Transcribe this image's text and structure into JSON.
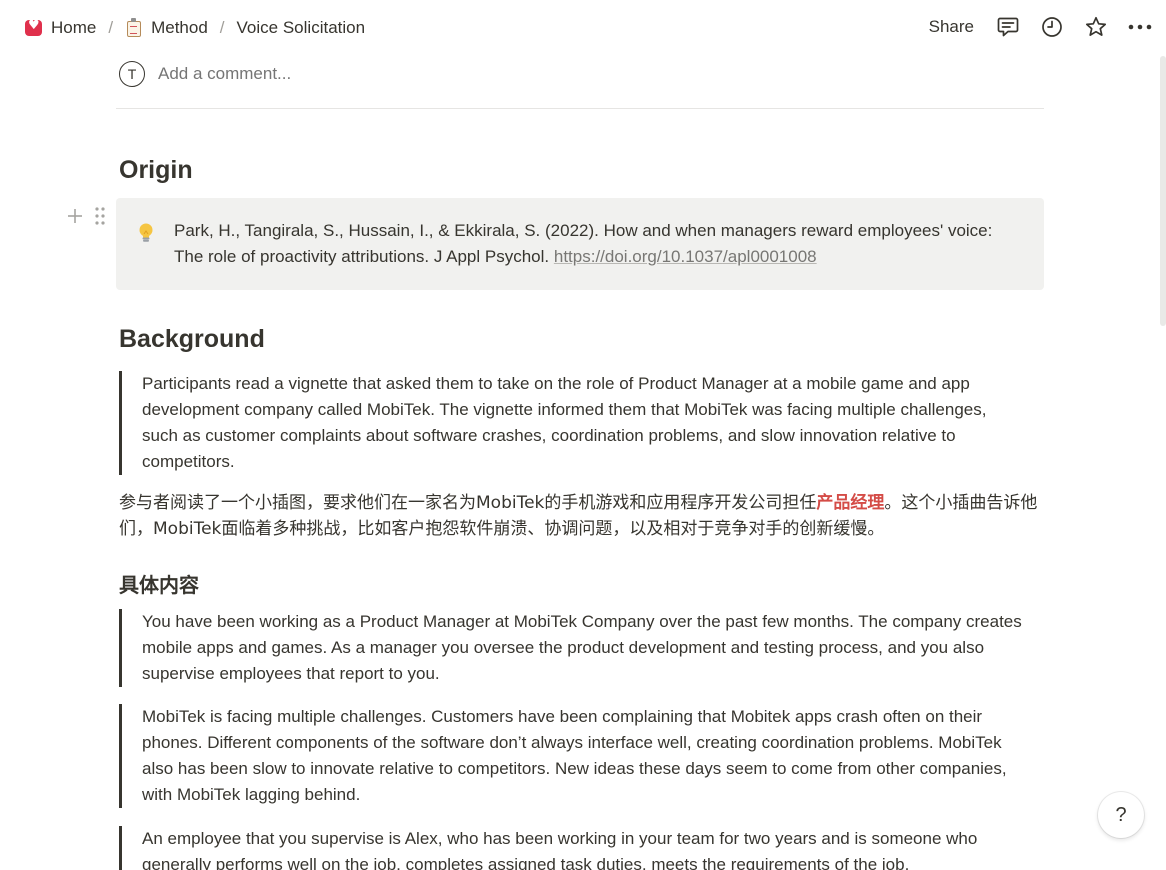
{
  "breadcrumb": {
    "home_label": "Home",
    "method_label": "Method",
    "page_label": "Voice Solicitation",
    "separator": "/"
  },
  "topbar": {
    "share_label": "Share"
  },
  "comment": {
    "avatar_initial": "T",
    "placeholder": "Add a comment..."
  },
  "origin": {
    "heading": "Origin",
    "citation": "Park, H., Tangirala, S., Hussain, I., & Ekkirala, S. (2022). How and when managers reward employees' voice: The role of proactivity attributions. J Appl Psychol.",
    "doi_link": "https://doi.org/10.1037/apl0001008"
  },
  "background": {
    "heading": "Background",
    "quote": "Participants read a vignette that asked them to take on the role of Product Manager at a mobile game and app development company called MobiTek. The vignette informed them that MobiTek was facing multiple challenges, such as customer complaints about software crashes, coordination problems, and slow innovation relative to competitors.",
    "cn_before": "参与者阅读了一个小插图，要求他们在一家名为MobiTek的手机游戏和应用程序开发公司担任",
    "cn_highlight": "产品经理",
    "cn_after": "。这个小插曲告诉他们，MobiTek面临着多种挑战，比如客户抱怨软件崩溃、协调问题，以及相对于竞争对手的创新缓慢。"
  },
  "details": {
    "heading": "具体内容",
    "quotes": [
      "You have been working as a Product Manager at MobiTek Company over the past few months. The company creates mobile apps and games. As a manager you oversee the product development and testing process, and you also supervise employees that report to you.",
      "MobiTek is facing multiple challenges. Customers have been complaining that Mobitek apps crash often on their phones. Different components of the software don’t always interface well, creating coordination problems. MobiTek also has been slow to innovate relative to competitors. New ideas these days seem to come from other companies, with MobiTek lagging behind.",
      "An employee that you supervise is Alex, who has been working in your team for two years and is someone who generally performs well on the job, completes assigned task duties, meets the requirements of the job."
    ]
  },
  "help": {
    "label": "?"
  },
  "icons": {
    "comments": "comment-icon",
    "updates": "clock-icon",
    "favorite": "star-icon",
    "more": "more-icon",
    "callout": "lightbulb-icon"
  },
  "colors": {
    "text": "#37352f",
    "callout_bg": "#f1f1ef",
    "highlight_red": "#d44c47",
    "home_icon_red": "#e0304c"
  }
}
